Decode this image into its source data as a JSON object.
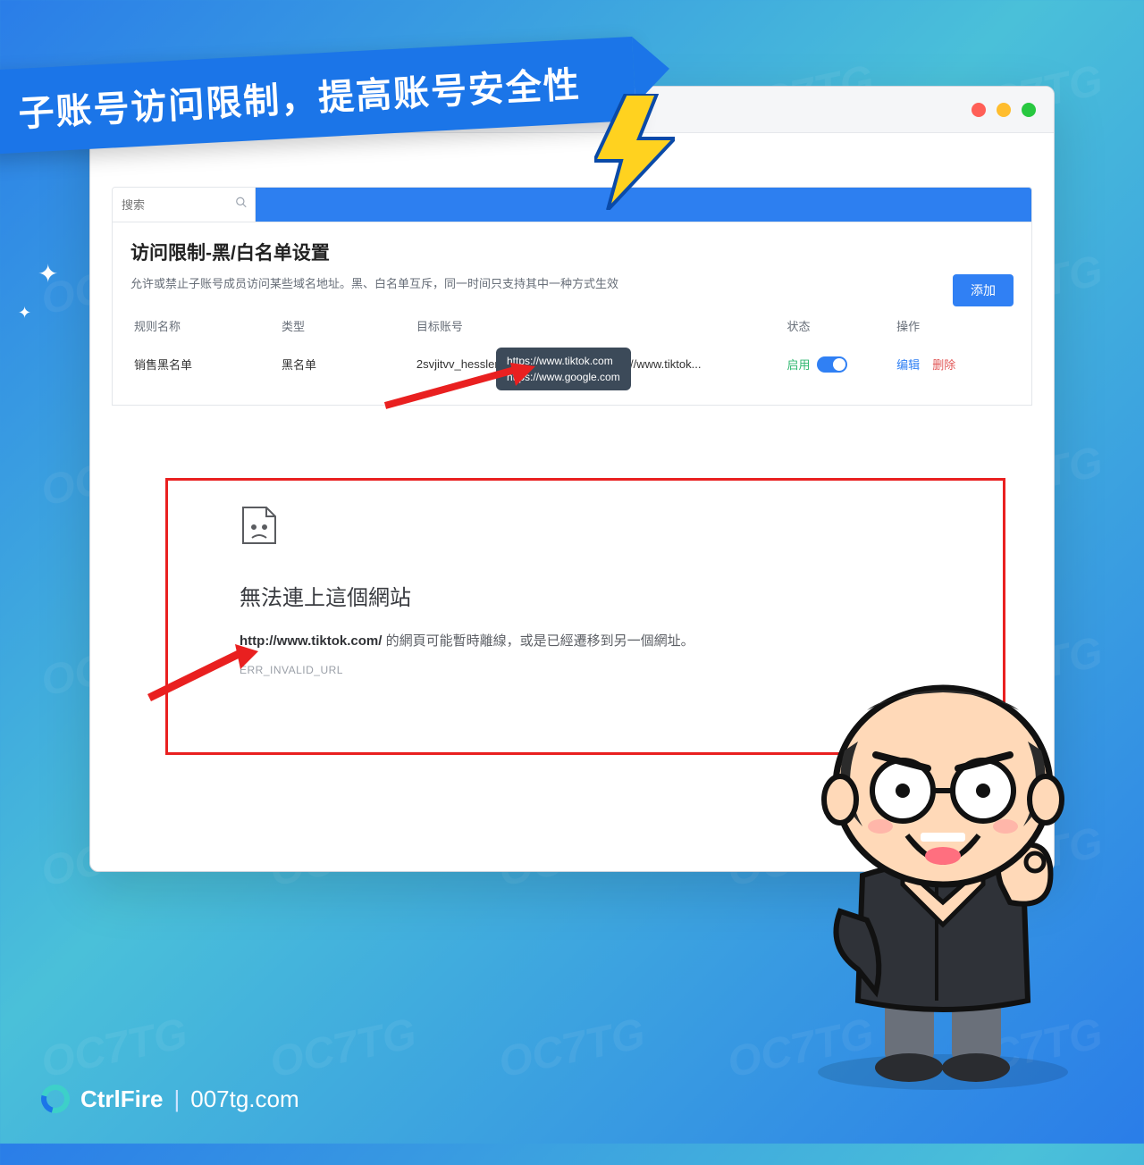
{
  "banner": {
    "text": "子账号访问限制，提高账号安全性"
  },
  "watermark": "OC7TG",
  "search": {
    "placeholder": "搜索"
  },
  "panel": {
    "title": "访问限制-黑/白名单设置",
    "desc": "允许或禁止子账号成员访问某些域名地址。黑、白名单互斥，同一时间只支持其中一种方式生效",
    "add_label": "添加"
  },
  "table": {
    "headers": {
      "name": "规则名称",
      "type": "类型",
      "target": "目标账号",
      "domain": "",
      "status": "状态",
      "ops": "操作"
    },
    "row": {
      "name": "销售黑名单",
      "type": "黑名单",
      "target": "2svjitvv_hesslerul...",
      "domain": "https://www.tiktok...",
      "status": "启用",
      "edit": "编辑",
      "del": "删除"
    }
  },
  "tooltip": {
    "line1": "https://www.tiktok.com",
    "line2": "https://www.google.com"
  },
  "error": {
    "title": "無法連上這個網站",
    "url": "http://www.tiktok.com/",
    "rest": " 的網頁可能暫時離線，或是已經遷移到另一個網址。",
    "code": "ERR_INVALID_URL"
  },
  "footer": {
    "brand": "CtrlFire",
    "sep": "|",
    "site": "007tg.com"
  }
}
